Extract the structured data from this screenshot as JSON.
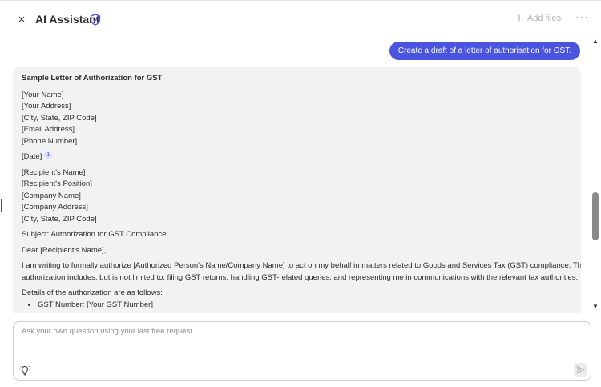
{
  "header": {
    "close_glyph": "×",
    "title": "AI Assistant",
    "add_files_label": "Add files",
    "more_glyph": "···"
  },
  "conversation": {
    "user_message": "Create a draft of a letter of authorisation for GST.",
    "answer": {
      "title": "Sample Letter of Authorization for GST",
      "sender_lines": [
        "[Your Name]",
        "[Your Address]",
        "[City, State, ZIP Code]",
        "[Email Address]",
        "[Phone Number]"
      ],
      "date_line": "[Date]",
      "citation": "1",
      "recipient_lines": [
        "[Recipient's Name]",
        "[Recipient's Position]",
        "[Company Name]",
        "[Company Address]",
        "[City, State, ZIP Code]"
      ],
      "subject": "Subject: Authorization for GST Compliance",
      "salutation": "Dear [Recipient's Name],",
      "body_line1": "I am writing to formally authorize [Authorized Person's Name/Company Name] to act on my behalf in matters related to Goods and Services Tax (GST) compliance. This",
      "body_line2": "authorization includes, but is not limited to, filing GST returns, handling GST-related queries, and representing me in communications with the relevant tax authorities.",
      "details_intro": "Details of the authorization are as follows:",
      "details_items": [
        "GST Number: [Your GST Number]"
      ]
    }
  },
  "composer": {
    "placeholder": "Ask your own question using your last free request"
  },
  "icons": {
    "verified": "shield-check-icon",
    "add": "plus-icon",
    "idea": "lightbulb-icon",
    "send": "send-icon"
  },
  "colors": {
    "accent": "#4a54e1",
    "answer_bg": "#f2f2f2"
  }
}
